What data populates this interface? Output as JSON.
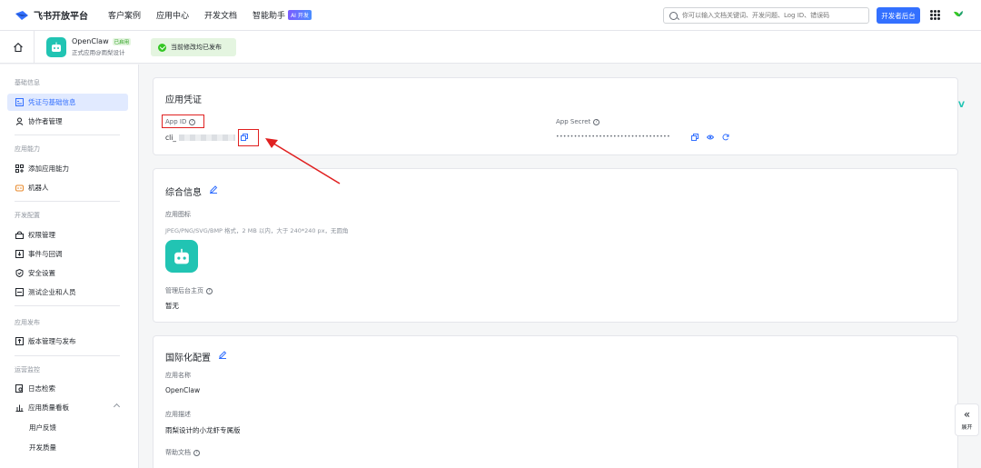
{
  "topnav": {
    "brand": "飞书开放平台",
    "links": [
      "客户案例",
      "应用中心",
      "开发文档",
      "智能助手"
    ],
    "ai_badge": "AI 开发",
    "search_placeholder": "你可以输入文档关键词、开发问题、Log ID、错误码",
    "dev_console": "开发者后台"
  },
  "subhead": {
    "app_name": "OpenClaw",
    "status": "已启用",
    "app_sub": "正式应用@雨梨设计",
    "publish_text": "当前修改均已发布"
  },
  "sidebar": {
    "groups": [
      "基础信息",
      "应用能力",
      "开发配置",
      "应用发布",
      "运营监控"
    ],
    "items": [
      "凭证与基础信息",
      "协作者管理",
      "添加应用能力",
      "机器人",
      "权限管理",
      "事件与回调",
      "安全设置",
      "测试企业和人员",
      "版本管理与发布",
      "日志检索",
      "应用质量看板"
    ],
    "subs": [
      "用户反馈",
      "开发质量"
    ]
  },
  "credentials": {
    "title": "应用凭证",
    "app_id_label": "App ID",
    "app_id_prefix": "cli_",
    "app_secret_label": "App Secret",
    "app_secret_masked": "••••••••••••••••••••••••••••••••"
  },
  "general": {
    "title": "综合信息",
    "icon_label": "应用图标",
    "icon_hint": "JPEG/PNG/SVG/BMP 格式，2 MB 以内，大于 240*240 px，无圆角",
    "admin_label": "管理后台主页",
    "admin_value": "暂无"
  },
  "i18n": {
    "title": "国际化配置",
    "name_label": "应用名称",
    "name_value": "OpenClaw",
    "desc_label": "应用描述",
    "desc_value": "雨梨设计的小龙虾专属版",
    "help_label": "帮助文档"
  },
  "expand": {
    "label": "展开"
  },
  "colors": {
    "primary": "#3370ff",
    "accent": "#21c4b3",
    "success": "#34c724",
    "annotation": "#e02020"
  }
}
